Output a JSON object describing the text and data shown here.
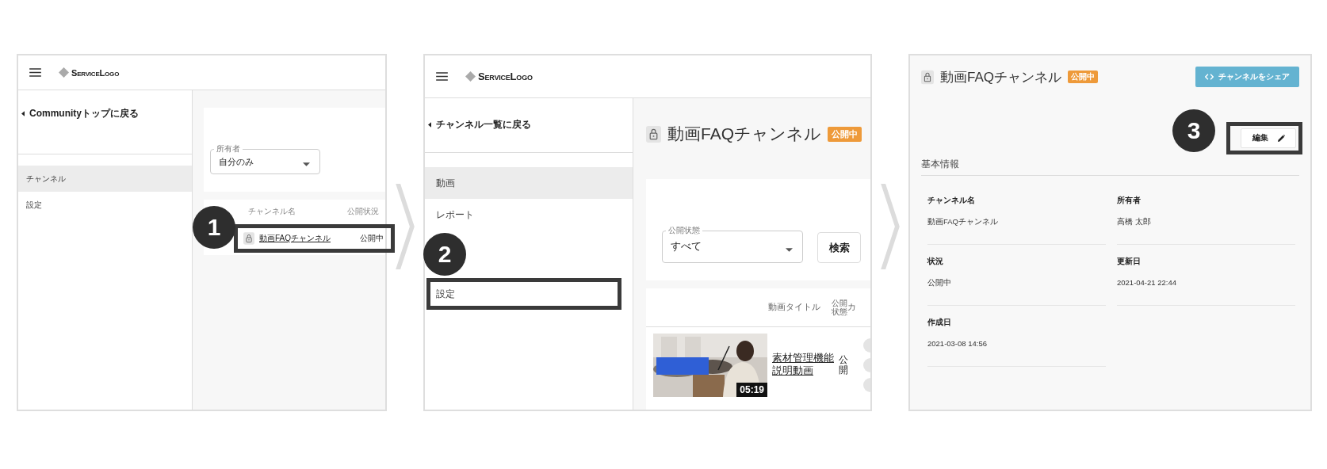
{
  "panels": [
    {
      "kind": "channel_list",
      "header": {
        "logo": "ServiceLogo"
      },
      "back_link": "Communityトップに戻る",
      "nav": [
        {
          "label": "チャンネル",
          "selected": true,
          "highlighted": false
        },
        {
          "label": "設定",
          "selected": false,
          "highlighted": false
        }
      ],
      "filter": {
        "label": "所有者",
        "value": "自分のみ"
      },
      "table": {
        "columns": [
          "チャンネル名",
          "公開状況"
        ],
        "rows": [
          {
            "name": "動画FAQチャンネル",
            "status": "公開中",
            "highlighted": true
          }
        ]
      },
      "step": "1"
    },
    {
      "kind": "channel_videos",
      "header": {
        "logo": "ServiceLogo"
      },
      "back_link": "チャンネル一覧に戻る",
      "nav": [
        {
          "label": "動画",
          "selected": true,
          "highlighted": false
        },
        {
          "label": "レポート",
          "selected": false,
          "highlighted": false
        },
        {
          "label": "設定",
          "selected": false,
          "highlighted": true
        }
      ],
      "title": "動画FAQチャンネル",
      "badge": "公開中",
      "filter": {
        "label": "公開状態",
        "value": "すべて"
      },
      "search_button": "検索",
      "table": {
        "columns": [
          "動画タイトル",
          "公開状態",
          "カ"
        ],
        "rows": [
          {
            "title": "素材管理機能説明動画",
            "duration": "05:19",
            "status": "公開",
            "kind": "picture"
          }
        ]
      },
      "step": "2"
    },
    {
      "kind": "channel_detail",
      "title": "動画FAQチャンネル",
      "badge": "公開中",
      "share_button": "チャンネルをシェア",
      "edit_button": {
        "label": "編集",
        "highlighted": true
      },
      "section": "基本情報",
      "fields": [
        {
          "label": "チャンネル名",
          "value": "動画FAQチャンネル"
        },
        {
          "label": "所有者",
          "value": "高橋 太郎"
        },
        {
          "label": "状況",
          "value": "公開中"
        },
        {
          "label": "更新日",
          "value": "2021-04-21 22:44"
        },
        {
          "label": "作成日",
          "value": "2021-03-08 14:56"
        }
      ],
      "step": "3"
    }
  ]
}
